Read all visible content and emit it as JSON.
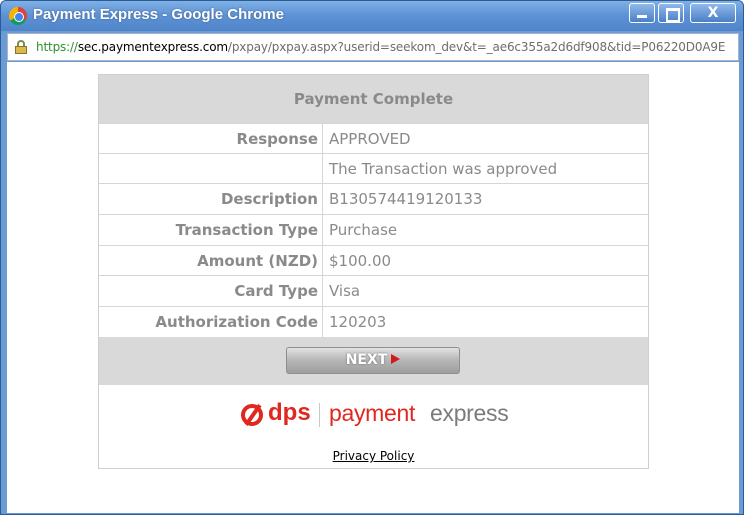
{
  "window": {
    "title": "Payment Express - Google Chrome",
    "close_label": "X"
  },
  "address": {
    "scheme": "https://",
    "host": "sec.paymentexpress.com",
    "path": "/pxpay/pxpay.aspx?userid=seekom_dev&t=_ae6c355a2d6df908&tid=P06220D0A9E"
  },
  "panel": {
    "header": "Payment Complete",
    "rows": [
      {
        "label": "Response",
        "value": "APPROVED"
      },
      {
        "label": "",
        "value": "The Transaction was approved"
      },
      {
        "label": "Description",
        "value": "B130574419120133"
      },
      {
        "label": "Transaction Type",
        "value": "Purchase"
      },
      {
        "label": "Amount (NZD)",
        "value": "$100.00"
      },
      {
        "label": "Card Type",
        "value": "Visa"
      },
      {
        "label": "Authorization Code",
        "value": "120203"
      }
    ],
    "next_label": "NEXT"
  },
  "logo": {
    "brand": "dps",
    "product_part1": "payment",
    "product_part2": "express"
  },
  "footer": {
    "privacy_link": "Privacy Policy"
  },
  "colors": {
    "accent_red": "#e0281e",
    "label_gray": "#8a8a8a",
    "header_bg": "#d9d9d9"
  }
}
